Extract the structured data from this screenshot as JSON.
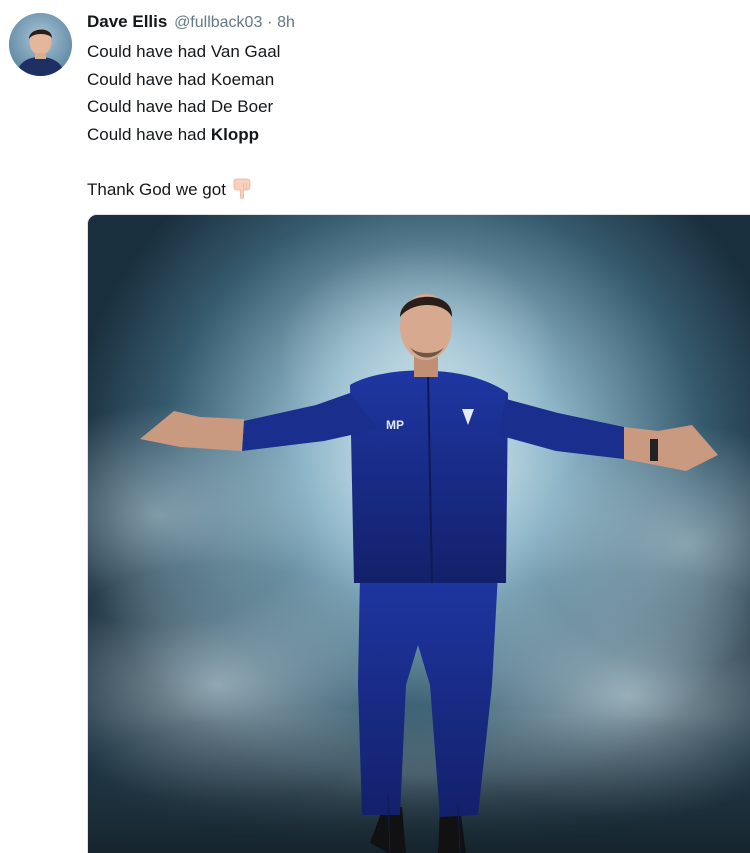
{
  "tweet": {
    "author": {
      "display_name": "Dave Ellis",
      "handle": "@fullback03"
    },
    "separator": "·",
    "time": "8h",
    "lines": [
      {
        "prefix": "Could have had ",
        "emphasis": "Van Gaal",
        "bold": false
      },
      {
        "prefix": "Could have had ",
        "emphasis": "Koeman",
        "bold": false
      },
      {
        "prefix": "Could have had ",
        "emphasis": "De Boer",
        "bold": false
      },
      {
        "prefix": "Could have had ",
        "emphasis": "Klopp",
        "bold": true
      }
    ],
    "closing_line": "Thank God we got",
    "closing_emoji": "backhand-index-pointing-down",
    "media": {
      "kit_initials": "MP"
    }
  },
  "colors": {
    "text": "#14171a",
    "secondary_text": "#657786",
    "kit_navy": "#15267a",
    "smoke": "#bcd4de"
  }
}
